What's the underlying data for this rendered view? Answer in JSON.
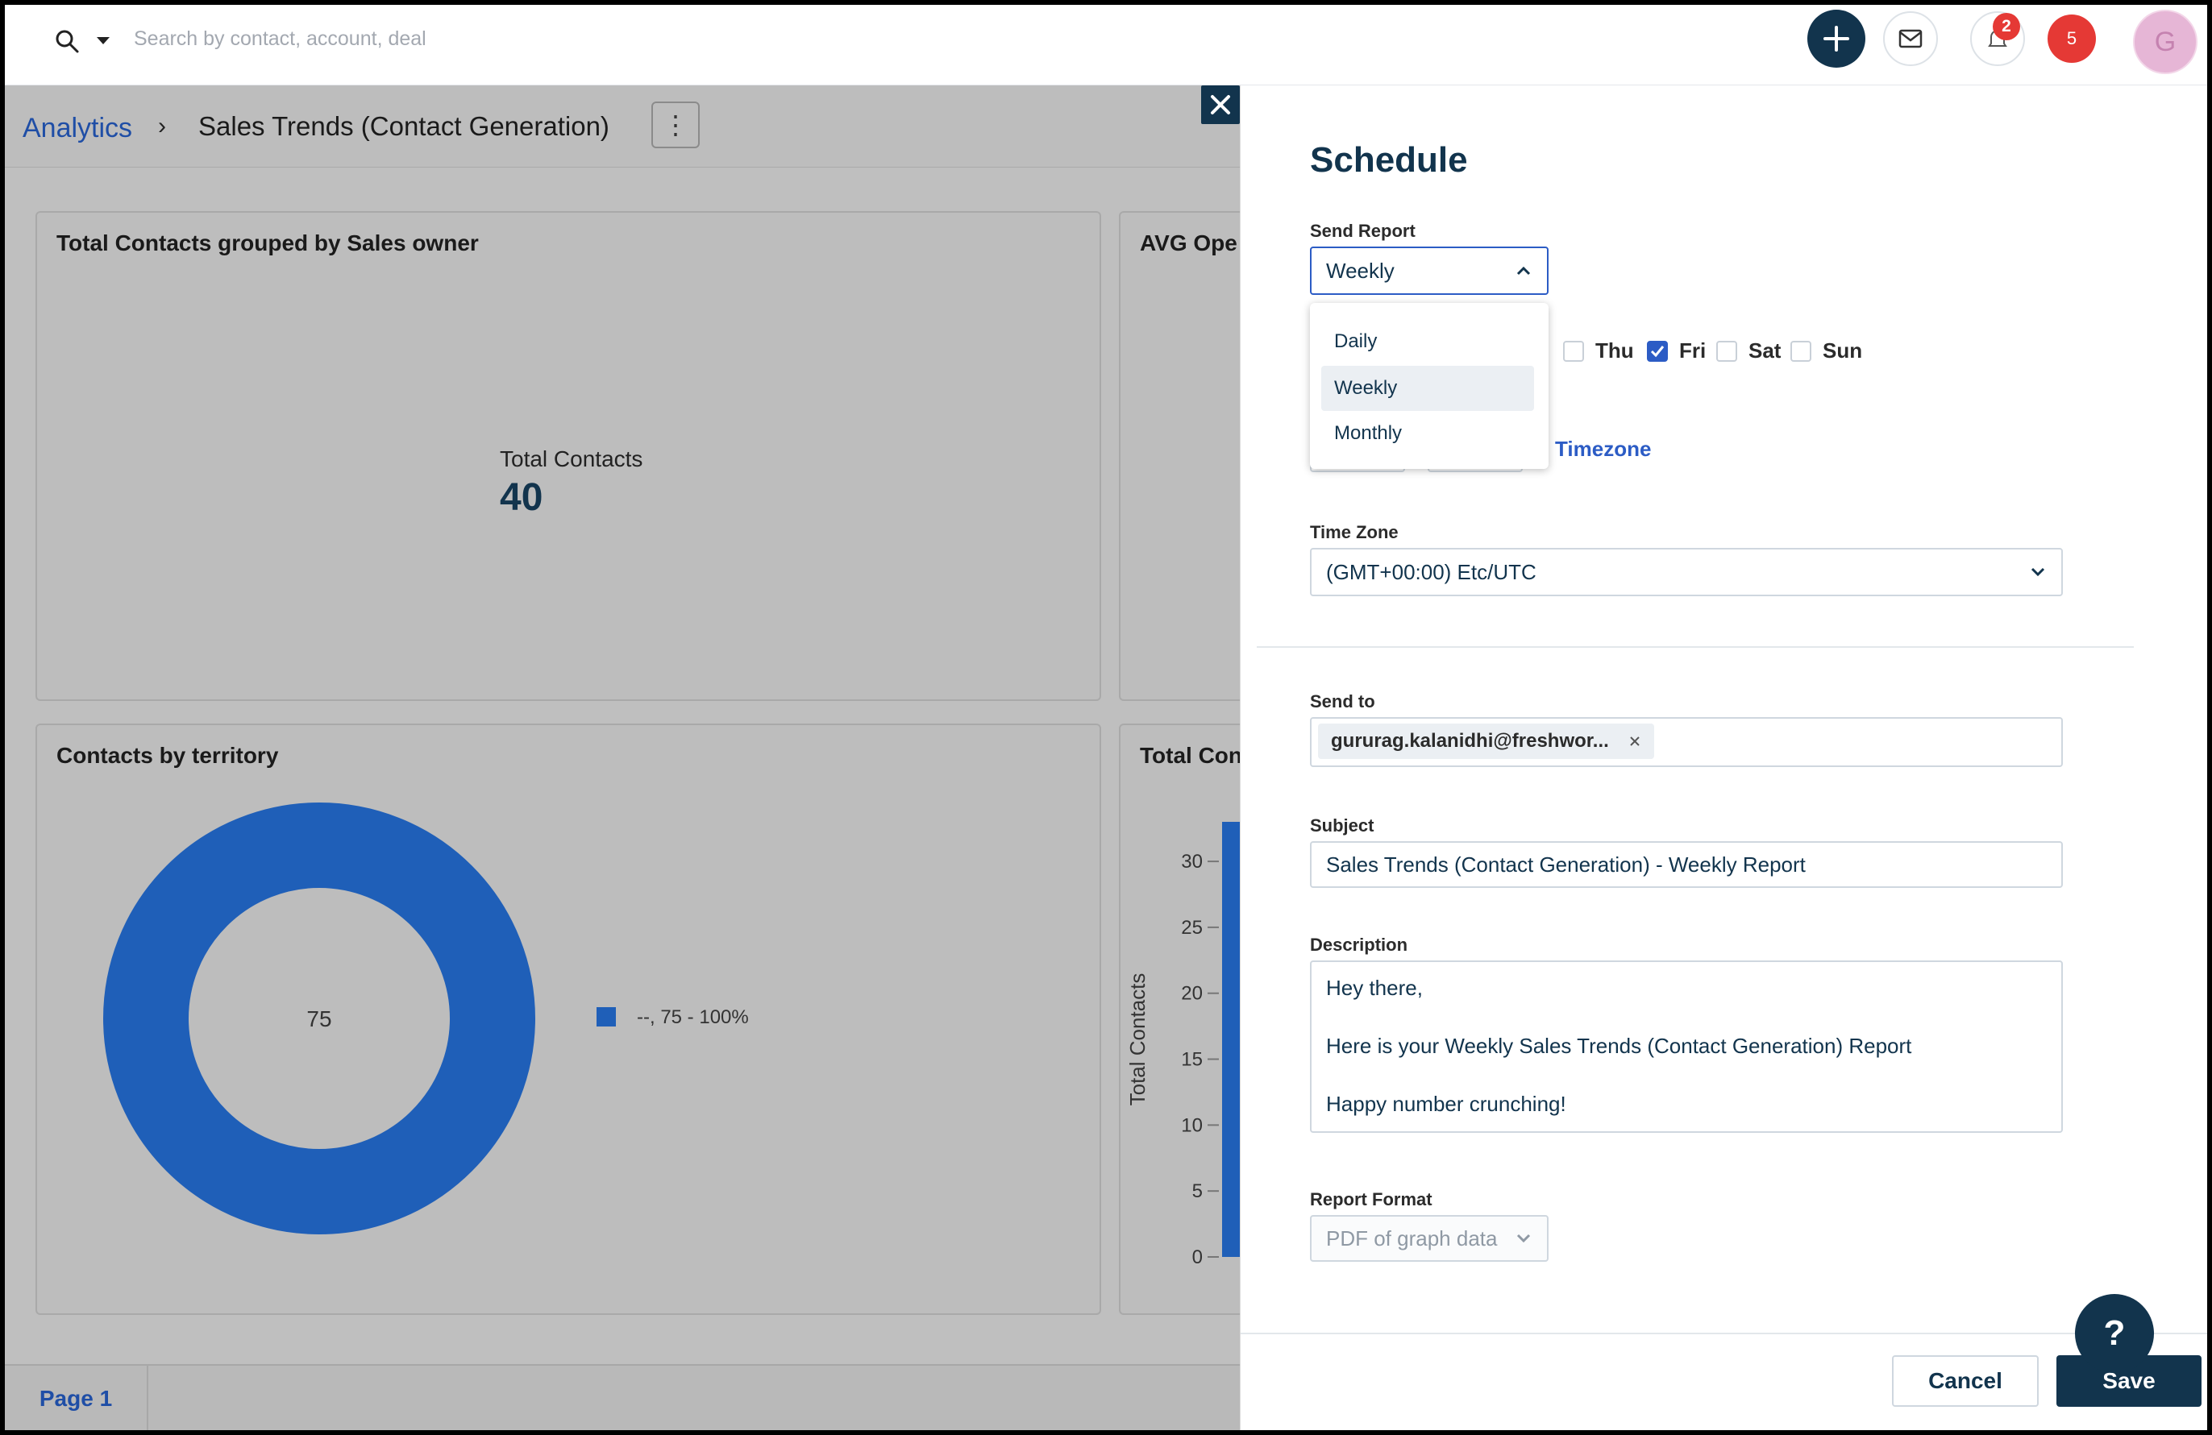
{
  "search": {
    "placeholder": "Search by contact, account, deal"
  },
  "topbar": {
    "notification_count": "2",
    "alert_count": "5",
    "avatar_initial": "G"
  },
  "breadcrumb": {
    "root": "Analytics",
    "separator": "›",
    "title": "Sales Trends (Contact Generation)",
    "kebab": "⋮"
  },
  "cards": {
    "total_contacts": {
      "title": "Total Contacts grouped by Sales owner",
      "kpi_label": "Total Contacts",
      "kpi_value": "40"
    },
    "avg_open": {
      "title": "AVG Ope"
    },
    "territory": {
      "title": "Contacts by territory"
    },
    "total_con": {
      "title": "Total Con"
    }
  },
  "chart_data": [
    {
      "type": "pie",
      "title": "Contacts by territory",
      "center_label": "75",
      "slices": [
        {
          "label": "--, 75 - 100%",
          "value": 75,
          "color": "#1f5fb8"
        }
      ],
      "legend": {
        "placement": "right",
        "entries": [
          "--, 75 - 100%"
        ]
      }
    },
    {
      "type": "bar",
      "title": "Total Con",
      "ylabel": "Total Contacts",
      "yticks": [
        "30",
        "25",
        "20",
        "15",
        "10",
        "5",
        "0"
      ],
      "ylim": [
        0,
        33
      ],
      "values": [
        33
      ],
      "color": "#1f5fb8"
    }
  ],
  "page_tabs": [
    "Page 1"
  ],
  "schedule": {
    "title": "Schedule",
    "send_report_label": "Send Report",
    "send_report_value": "Weekly",
    "frequency_options": [
      "Daily",
      "Weekly",
      "Monthly"
    ],
    "selected_frequency": "Weekly",
    "days": [
      {
        "label": "Thu",
        "checked": false
      },
      {
        "label": "Fri",
        "checked": true
      },
      {
        "label": "Sat",
        "checked": false
      },
      {
        "label": "Sun",
        "checked": false
      }
    ],
    "timezone_link": "Timezone",
    "time_zone_label": "Time Zone",
    "time_zone_value": "(GMT+00:00) Etc/UTC",
    "send_to_label": "Send to",
    "send_to_chip": "gururag.kalanidhi@freshwor...",
    "subject_label": "Subject",
    "subject_value": "Sales Trends (Contact Generation) - Weekly Report",
    "description_label": "Description",
    "description_lines": [
      "Hey there,",
      "",
      "Here is your Weekly Sales Trends (Contact Generation) Report",
      "",
      "Happy number crunching!"
    ],
    "report_format_label": "Report Format",
    "report_format_value": "PDF of graph data",
    "cancel_label": "Cancel",
    "save_label": "Save"
  },
  "help": {
    "label": "?"
  },
  "colors": {
    "primary": "#12344d",
    "accent": "#2c5cc5",
    "chart": "#1f5fb8",
    "alert": "#e53935"
  }
}
